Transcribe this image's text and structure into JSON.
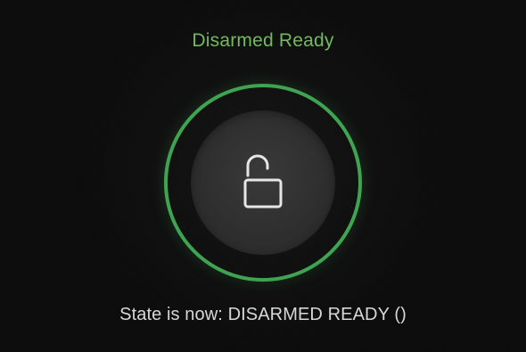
{
  "header": {
    "title": "Disarmed Ready"
  },
  "main": {
    "lock_button": {
      "icon": "unlocked-padlock-icon",
      "accent_color": "#3fa451"
    }
  },
  "footer": {
    "status_message": "State is now: DISARMED READY ()"
  },
  "colors": {
    "title_text": "#73b95f",
    "background": "#0c0c0c",
    "button_fill": "#2e2e2e",
    "message_text": "#d7d7d7"
  }
}
